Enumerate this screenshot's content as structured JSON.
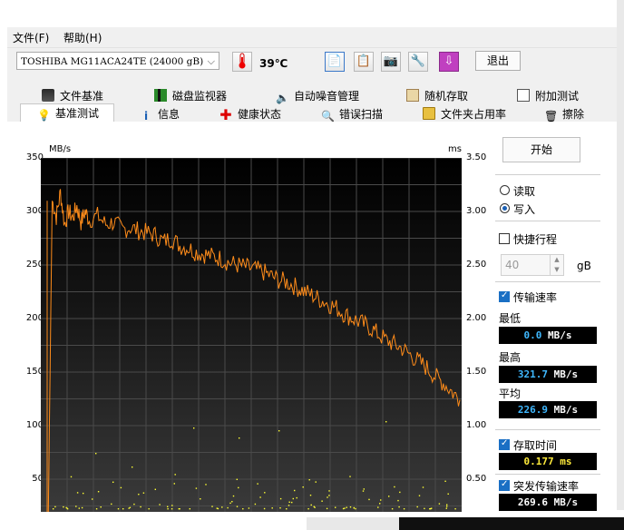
{
  "menu": {
    "file": "文件(F)",
    "help": "帮助(H)"
  },
  "toolbar": {
    "drive": "TOSHIBA MG11ACA24TE (24000 gB)",
    "temperature": "39℃",
    "exit_label": "退出",
    "icons": [
      "copy-text-icon",
      "copy-screenshot-icon",
      "camera-icon",
      "options-icon",
      "download-icon"
    ]
  },
  "tabs_top": [
    {
      "label": "文件基准",
      "icon": "file-benchmark-icon"
    },
    {
      "label": "磁盘监视器",
      "icon": "disk-monitor-icon"
    },
    {
      "label": "自动噪音管理",
      "icon": "speaker-icon"
    },
    {
      "label": "随机存取",
      "icon": "random-access-icon"
    },
    {
      "label": "附加测试",
      "icon": "extra-tests-icon"
    }
  ],
  "tabs_bottom": [
    {
      "label": "基准测试",
      "icon": "benchmark-icon",
      "active": true
    },
    {
      "label": "信息",
      "icon": "info-icon"
    },
    {
      "label": "健康状态",
      "icon": "health-icon"
    },
    {
      "label": "错误扫描",
      "icon": "error-scan-icon"
    },
    {
      "label": "文件夹占用率",
      "icon": "folder-usage-icon"
    },
    {
      "label": "擦除",
      "icon": "erase-icon"
    }
  ],
  "panel": {
    "start_label": "开始",
    "read_label": "读取",
    "write_label": "写入",
    "mode_selected": "写入",
    "short_stroke_label": "快捷行程",
    "short_stroke_checked": false,
    "short_stroke_value": "40",
    "short_stroke_unit": "gB",
    "transfer_rate_label": "传输速率",
    "transfer_rate_checked": true,
    "min_label": "最低",
    "min_value": "0.0 MB/s",
    "max_label": "最高",
    "max_value": "321.7 MB/s",
    "avg_label": "平均",
    "avg_value": "226.9 MB/s",
    "access_time_label": "存取时间",
    "access_time_checked": true,
    "access_time_value": "0.177 ms",
    "burst_label": "突发传输速率",
    "burst_checked": true,
    "burst_value": "269.6 MB/s"
  },
  "colors": {
    "transfer_line": "#ff8c1a",
    "access_points": "#ffff33",
    "readout_value": "#3fb8ff"
  },
  "chart_data": {
    "type": "line",
    "ylabel": "MB/s",
    "y2label": "ms",
    "ylim": [
      0,
      350
    ],
    "y2lim": [
      0,
      3.5
    ],
    "yticks": [
      "350",
      "300",
      "250",
      "200",
      "150",
      "100",
      "50"
    ],
    "y2ticks": [
      "3.50",
      "3.00",
      "2.50",
      "2.00",
      "1.50",
      "1.00",
      "0.50"
    ],
    "grid": true,
    "series": [
      {
        "name": "传输速率",
        "x": [
          0,
          1,
          2,
          3,
          4,
          5,
          6,
          7,
          8,
          9,
          10,
          12,
          14,
          16,
          18,
          20,
          22,
          24,
          26,
          28,
          30,
          32,
          34,
          36,
          38,
          40,
          42,
          44,
          46,
          48,
          50,
          52,
          54,
          56,
          58,
          60,
          62,
          64,
          66,
          68,
          70,
          72,
          74,
          76,
          78,
          80,
          82,
          84,
          86,
          88,
          90,
          92,
          94,
          96,
          98,
          100
        ],
        "values": [
          0,
          310,
          295,
          318,
          288,
          300,
          294,
          305,
          290,
          300,
          292,
          296,
          288,
          290,
          283,
          285,
          282,
          280,
          278,
          272,
          275,
          268,
          266,
          262,
          260,
          258,
          256,
          252,
          250,
          248,
          246,
          244,
          240,
          236,
          234,
          230,
          226,
          222,
          218,
          214,
          210,
          204,
          200,
          196,
          192,
          186,
          180,
          176,
          172,
          166,
          160,
          154,
          146,
          140,
          132,
          124
        ]
      }
    ]
  }
}
